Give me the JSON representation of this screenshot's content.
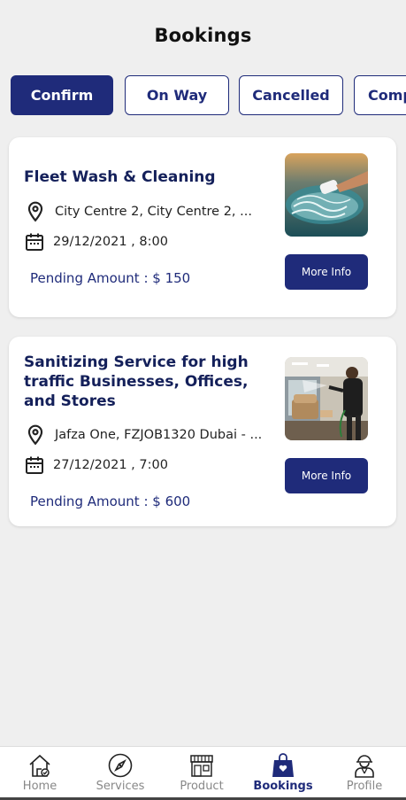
{
  "header": {
    "title": "Bookings"
  },
  "tabs": [
    {
      "label": "Confirm",
      "active": true
    },
    {
      "label": "On Way",
      "active": false
    },
    {
      "label": "Cancelled",
      "active": false
    },
    {
      "label": "Completed",
      "active": false
    }
  ],
  "bookings": [
    {
      "title": "Fleet Wash & Cleaning",
      "location": "City Centre 2, City Centre 2, ...",
      "datetime": "29/12/2021 , 8:00",
      "pending": "Pending Amount : $ 150",
      "button": "More Info",
      "image": "car-wash-photo"
    },
    {
      "title": "Sanitizing Service for high traffic Businesses, Offices, and Stores",
      "location": "Jafza One, FZJOB1320 Dubai - ...",
      "datetime": "27/12/2021 , 7:00",
      "pending": "Pending Amount : $ 600",
      "button": "More Info",
      "image": "sanitizing-photo"
    }
  ],
  "nav": [
    {
      "label": "Home",
      "icon": "home-icon",
      "active": false
    },
    {
      "label": "Services",
      "icon": "compass-icon",
      "active": false
    },
    {
      "label": "Product",
      "icon": "store-icon",
      "active": false
    },
    {
      "label": "Bookings",
      "icon": "shopping-bag-icon",
      "active": true
    },
    {
      "label": "Profile",
      "icon": "worker-icon",
      "active": false
    }
  ],
  "colors": {
    "primary": "#1f2b7a",
    "background": "#efefef",
    "card": "#ffffff"
  }
}
